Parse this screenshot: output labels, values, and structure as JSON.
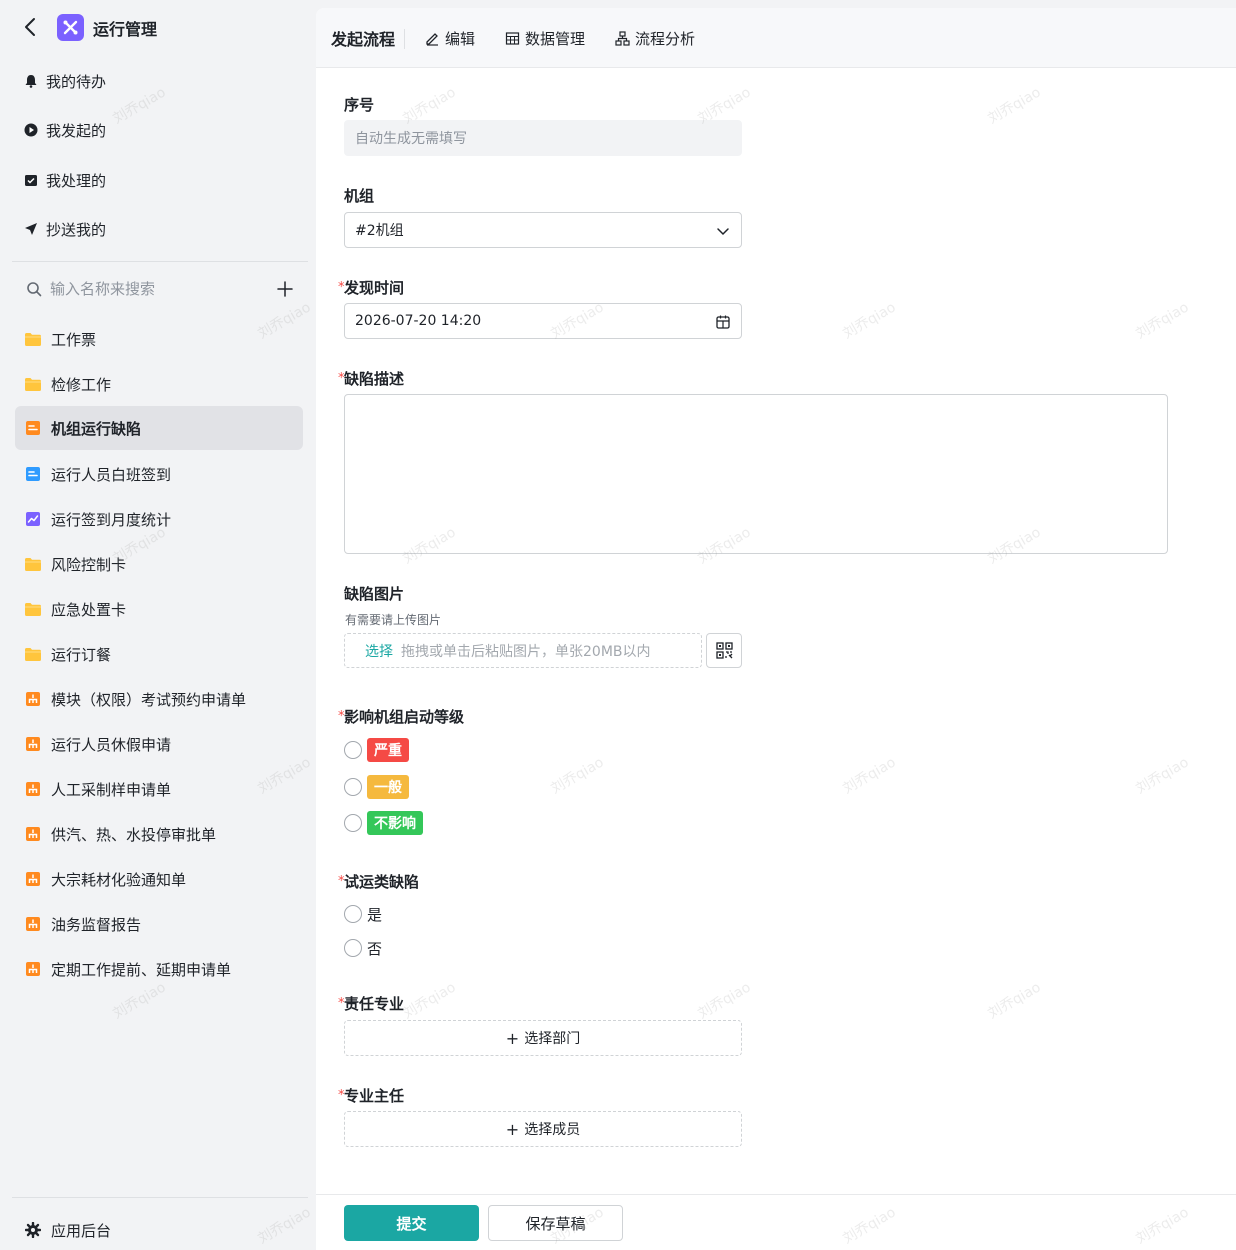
{
  "app": {
    "title": "运行管理"
  },
  "sidebar": {
    "quick": [
      {
        "label": "我的待办",
        "icon": "bell-icon"
      },
      {
        "label": "我发起的",
        "icon": "play-icon"
      },
      {
        "label": "我处理的",
        "icon": "inbox-check-icon"
      },
      {
        "label": "抄送我的",
        "icon": "send-icon"
      }
    ],
    "search_placeholder": "输入名称来搜索",
    "items": [
      {
        "label": "工作票",
        "icon": "folder-icon",
        "active": false
      },
      {
        "label": "检修工作",
        "icon": "folder-icon",
        "active": false
      },
      {
        "label": "机组运行缺陷",
        "icon": "form-orange-icon",
        "active": true
      },
      {
        "label": "运行人员白班签到",
        "icon": "form-blue-icon",
        "active": false
      },
      {
        "label": "运行签到月度统计",
        "icon": "chart-icon",
        "active": false
      },
      {
        "label": "风险控制卡",
        "icon": "folder-icon",
        "active": false
      },
      {
        "label": "应急处置卡",
        "icon": "folder-icon",
        "active": false
      },
      {
        "label": "运行订餐",
        "icon": "folder-icon",
        "active": false
      },
      {
        "label": "模块（权限）考试预约申请单",
        "icon": "flow-icon",
        "active": false
      },
      {
        "label": "运行人员休假申请",
        "icon": "flow-icon",
        "active": false
      },
      {
        "label": "人工采制样申请单",
        "icon": "flow-icon",
        "active": false
      },
      {
        "label": "供汽、热、水投停审批单",
        "icon": "flow-icon",
        "active": false
      },
      {
        "label": "大宗耗材化验通知单",
        "icon": "flow-icon",
        "active": false
      },
      {
        "label": "油务监督报告",
        "icon": "flow-icon",
        "active": false
      },
      {
        "label": "定期工作提前、延期申请单",
        "icon": "flow-icon",
        "active": false
      }
    ],
    "footer_label": "应用后台"
  },
  "tabs": [
    {
      "label": "发起流程",
      "icon": ""
    },
    {
      "label": "编辑",
      "icon": "pencil-icon"
    },
    {
      "label": "数据管理",
      "icon": "table-icon"
    },
    {
      "label": "流程分析",
      "icon": "org-chart-icon"
    }
  ],
  "form": {
    "serial": {
      "label": "序号",
      "placeholder": "自动生成无需填写"
    },
    "unit": {
      "label": "机组",
      "value": "#2机组"
    },
    "found_time": {
      "label": "发现时间",
      "value": "2026-07-20 14:20"
    },
    "description": {
      "label": "缺陷描述"
    },
    "images": {
      "label": "缺陷图片",
      "hint": "有需要请上传图片",
      "select": "选择",
      "placeholder": "拖拽或单击后粘贴图片，单张20MB以内"
    },
    "level": {
      "label": "影响机组启动等级",
      "options": [
        {
          "label": "严重",
          "color": "#f54a45"
        },
        {
          "label": "一般",
          "color": "#f5b93e"
        },
        {
          "label": "不影响",
          "color": "#34c759"
        }
      ]
    },
    "trial": {
      "label": "试运类缺陷",
      "options": [
        "是",
        "否"
      ]
    },
    "responsible": {
      "label": "责任专业",
      "button": "选择部门"
    },
    "director": {
      "label": "专业主任",
      "button": "选择成员"
    },
    "required_mark": "*"
  },
  "actions": {
    "submit": "提交",
    "draft": "保存草稿"
  },
  "watermark": "刘乔qiao",
  "colors": {
    "accent": "#1ba7a3",
    "logo": "#7b61ff",
    "folder": "#ffc53d",
    "orange": "#ff8a1f",
    "blue": "#2f9bff"
  }
}
